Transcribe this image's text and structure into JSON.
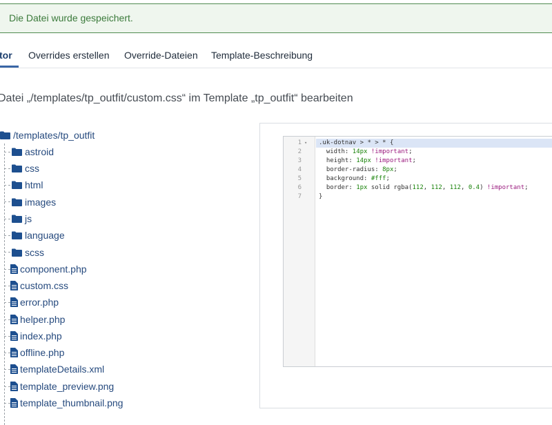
{
  "alert": {
    "message": "Die Datei wurde gespeichert."
  },
  "tabs": [
    {
      "label": "tor",
      "active": true
    },
    {
      "label": "Overrides erstellen"
    },
    {
      "label": "Override-Dateien"
    },
    {
      "label": "Template-Beschreibung"
    }
  ],
  "heading": "Datei „/templates/tp_outfit/custom.css“ im Template „tp_outfit“ bearbeiten",
  "tree": {
    "root": "/templates/tp_outfit",
    "folders": [
      "astroid",
      "css",
      "html",
      "images",
      "js",
      "language",
      "scss"
    ],
    "files": [
      "component.php",
      "custom.css",
      "error.php",
      "helper.php",
      "index.php",
      "offline.php",
      "templateDetails.xml",
      "template_preview.png",
      "template_thumbnail.png"
    ]
  },
  "editor": {
    "line_numbers": [
      "1",
      "2",
      "3",
      "4",
      "5",
      "6",
      "7"
    ],
    "fold_marker": "▾",
    "lines": [
      [
        {
          "t": ".uk-dotnav > * > * {",
          "c": "sel"
        }
      ],
      [
        {
          "t": "  width: ",
          "c": "prop"
        },
        {
          "t": "14px",
          "c": "num"
        },
        {
          "t": " ",
          "c": "plain"
        },
        {
          "t": "!important",
          "c": "imp"
        },
        {
          "t": ";",
          "c": "plain"
        }
      ],
      [
        {
          "t": "  height: ",
          "c": "prop"
        },
        {
          "t": "14px",
          "c": "num"
        },
        {
          "t": " ",
          "c": "plain"
        },
        {
          "t": "!important",
          "c": "imp"
        },
        {
          "t": ";",
          "c": "plain"
        }
      ],
      [
        {
          "t": "  border-radius: ",
          "c": "prop"
        },
        {
          "t": "8px",
          "c": "num"
        },
        {
          "t": ";",
          "c": "plain"
        }
      ],
      [
        {
          "t": "  background: ",
          "c": "prop"
        },
        {
          "t": "#fff",
          "c": "hex"
        },
        {
          "t": ";",
          "c": "plain"
        }
      ],
      [
        {
          "t": "  border: ",
          "c": "prop"
        },
        {
          "t": "1px",
          "c": "num"
        },
        {
          "t": " solid rgba(",
          "c": "plain"
        },
        {
          "t": "112",
          "c": "num"
        },
        {
          "t": ", ",
          "c": "plain"
        },
        {
          "t": "112",
          "c": "num"
        },
        {
          "t": ", ",
          "c": "plain"
        },
        {
          "t": "112",
          "c": "num"
        },
        {
          "t": ", ",
          "c": "plain"
        },
        {
          "t": "0.4",
          "c": "num"
        },
        {
          "t": ") ",
          "c": "plain"
        },
        {
          "t": "!important",
          "c": "imp"
        },
        {
          "t": ";",
          "c": "plain"
        }
      ],
      [
        {
          "t": "}",
          "c": "plain"
        }
      ]
    ]
  },
  "colors": {
    "accent": "#3a66a6",
    "link": "#264a7e",
    "alert_bg": "#eff6ee",
    "alert_border": "#4f8a4f"
  }
}
